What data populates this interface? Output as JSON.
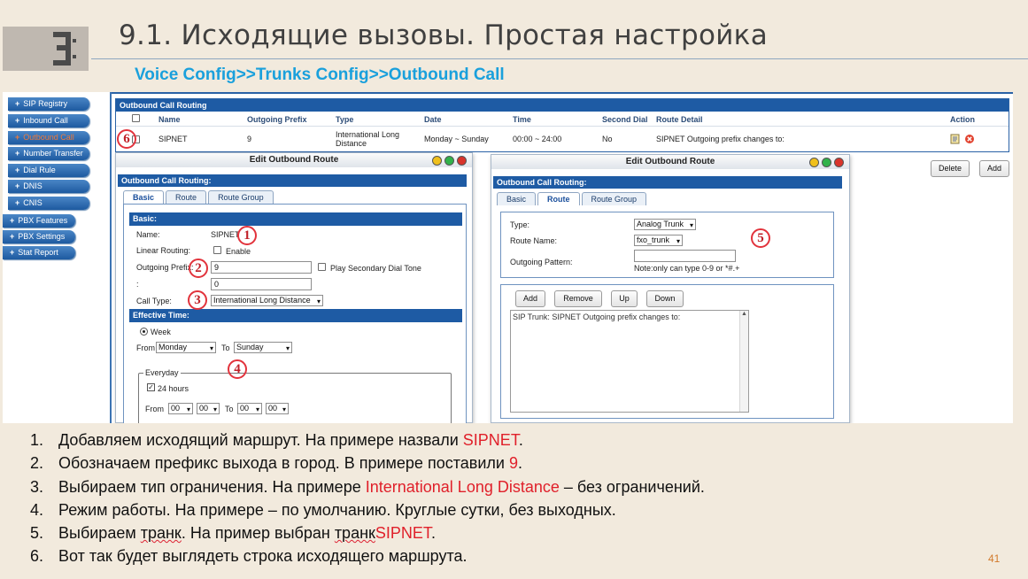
{
  "slide": {
    "title": "9.1. Исходящие вызовы. Простая настройка",
    "subtitle": "Voice Config>>Trunks Config>>Outbound Call",
    "page_number": "41"
  },
  "sidebar": {
    "items": [
      {
        "label": "SIP Registry"
      },
      {
        "label": "Inbound Call"
      },
      {
        "label": "Outbound Call"
      },
      {
        "label": "Number Transfer"
      },
      {
        "label": "Dial Rule"
      },
      {
        "label": "DNIS"
      },
      {
        "label": "CNIS"
      },
      {
        "label": "PBX Features"
      },
      {
        "label": "PBX Settings"
      },
      {
        "label": "Stat Report"
      }
    ],
    "item_prefix": "+"
  },
  "routing_table": {
    "header": "Outbound Call Routing",
    "columns": [
      "Name",
      "Outgoing Prefix",
      "Type",
      "Date",
      "Time",
      "Second Dial",
      "Route Detail",
      "Action"
    ],
    "row": {
      "name": "SIPNET",
      "prefix": "9",
      "type": "International Long Distance",
      "date": "Monday ~ Sunday",
      "time": "00:00 ~ 24:00",
      "second_dial": "No",
      "route_detail": "SIPNET Outgoing prefix changes to:"
    },
    "delete_label": "Delete",
    "add_label": "Add"
  },
  "dialog_left": {
    "title": "Edit Outbound Route",
    "header": "Outbound Call Routing:",
    "tabs": [
      "Basic",
      "Route",
      "Route Group"
    ],
    "basic_head": "Basic:",
    "name_label": "Name:",
    "name_value": "SIPNET",
    "linear_label": "Linear Routing:",
    "enable_label": "Enable",
    "prefix_label": "Outgoing Prefix:",
    "prefix_value": "9",
    "play_label": "Play Secondary Dial Tone",
    "colon_label": ":",
    "second_value": "0",
    "calltype_label": "Call Type:",
    "calltype_value": "International Long Distance",
    "effective_head": "Effective Time:",
    "week_label": "Week",
    "from_label": "From",
    "from_day": "Monday",
    "to_label": "To",
    "to_day": "Sunday",
    "everyday_label": "Everyday",
    "hours_label": "24 hours",
    "time_from_label": "From",
    "time_to_label": "To",
    "time_value": "00"
  },
  "dialog_right": {
    "title": "Edit Outbound Route",
    "header": "Outbound Call Routing:",
    "tabs": [
      "Basic",
      "Route",
      "Route Group"
    ],
    "type_label": "Type:",
    "type_value": "Analog Trunk",
    "route_name_label": "Route Name:",
    "route_name_value": "fxo_trunk",
    "pattern_label": "Outgoing Pattern:",
    "pattern_note": "Note:only can type 0-9 or *#.+",
    "buttons": [
      "Add",
      "Remove",
      "Up",
      "Down"
    ],
    "route_text": "SIP Trunk: SIPNET Outgoing prefix changes to:"
  },
  "markers": [
    "1",
    "2",
    "3",
    "4",
    "5",
    "6"
  ],
  "steps": [
    {
      "num": "1.",
      "text": "Добавляем исходящий маршрут. На примере назвали ",
      "highlight": "SIPNET",
      "tail": "."
    },
    {
      "num": "2.",
      "text": "Обозначаем префикс выхода в город. В примере поставили ",
      "highlight": "9",
      "tail": "."
    },
    {
      "num": "3.",
      "text": "Выбираем тип ограничения. На примере ",
      "highlight": "International Long Distance",
      "tail": " – без ограничений."
    },
    {
      "num": "4.",
      "text": "Режим работы. На примере – по умолчанию. Круглые сутки, без выходных.",
      "highlight": "",
      "tail": ""
    },
    {
      "num": "5.",
      "text_a": "Выбираем ",
      "word1": "транк",
      "text_b": ". На пример выбран ",
      "word2": "транк",
      "highlight": "SIPNET",
      "tail": "."
    },
    {
      "num": "6.",
      "text": "Вот так будет выглядеть строка исходящего маршрута.",
      "highlight": "",
      "tail": ""
    }
  ],
  "colors": {
    "accent_blue": "#1e5ba4",
    "subtitle_blue": "#1aa0dc",
    "highlight_red": "#e0202a",
    "background": "#f2eadd"
  }
}
